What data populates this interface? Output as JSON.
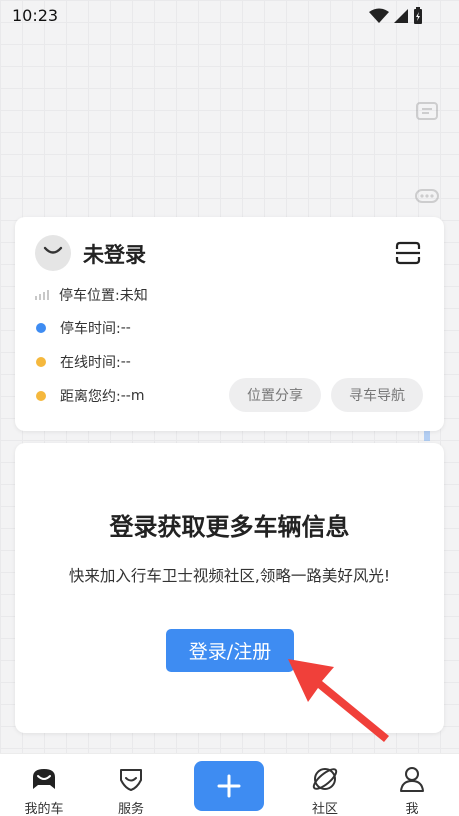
{
  "status_bar": {
    "time": "10:23"
  },
  "parking": {
    "login_status": "未登录",
    "rows": [
      {
        "label": "停车位置:",
        "value": "未知",
        "color": "#c8c8c8"
      },
      {
        "label": "停车时间:",
        "value": "--",
        "color": "#3e8cf2"
      },
      {
        "label": "在线时间:",
        "value": "--",
        "color": "#f5b83d"
      },
      {
        "label": "距离您约:",
        "value": "--m",
        "color": "#f5b83d"
      }
    ],
    "share_button": "位置分享",
    "navigate_button": "寻车导航"
  },
  "promo": {
    "title": "登录获取更多车辆信息",
    "description": "快来加入行车卫士视频社区,领略一路美好风光!",
    "login_button": "登录/注册"
  },
  "nav": {
    "items": [
      {
        "label": "我的车"
      },
      {
        "label": "服务"
      },
      {
        "label": "社区"
      },
      {
        "label": "我"
      }
    ]
  },
  "colors": {
    "accent": "#3e8cf2",
    "arrow": "#f0403a"
  }
}
